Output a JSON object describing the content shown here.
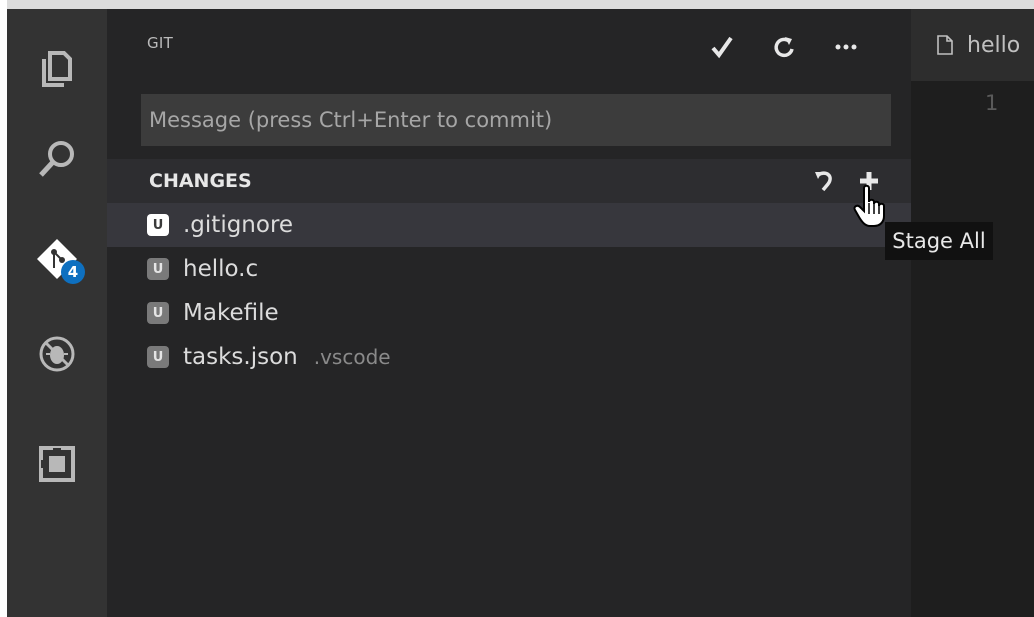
{
  "sidebar": {
    "title": "GIT",
    "actions": [
      {
        "icon": "check-icon"
      },
      {
        "icon": "refresh-icon"
      },
      {
        "icon": "more-icon"
      }
    ],
    "commit_placeholder": "Message (press Ctrl+Enter to commit)",
    "commit_value": ""
  },
  "changes": {
    "title": "CHANGES",
    "files": [
      {
        "badge": "U",
        "name": ".gitignore",
        "dir": ""
      },
      {
        "badge": "U",
        "name": "hello.c",
        "dir": ""
      },
      {
        "badge": "U",
        "name": "Makefile",
        "dir": ""
      },
      {
        "badge": "U",
        "name": "tasks.json",
        "dir": ".vscode"
      }
    ]
  },
  "tooltip": "Stage All",
  "activity": {
    "items": [
      "explorer-icon",
      "search-icon",
      "git-icon",
      "debug-icon",
      "extensions-icon"
    ],
    "git_badge": "4"
  },
  "editor": {
    "tab_label": "hello",
    "line_number": "1"
  },
  "colors": {
    "badge": "#0e70c0",
    "sidebar_bg": "#252526",
    "activity_bg": "#333333"
  }
}
